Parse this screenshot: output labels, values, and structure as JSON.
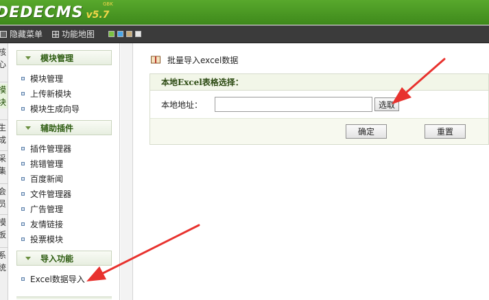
{
  "header": {
    "logo_text": "DEDECMS",
    "logo_version": "v5.7",
    "logo_sub": "GBK"
  },
  "toolbar": {
    "hide_menu_label": "隐藏菜单",
    "function_map_label": "功能地图",
    "color_swatches": [
      "#7bc142",
      "#4aa6e8",
      "#c7ab7a",
      "#e5e5e5"
    ]
  },
  "vertical_tabs": [
    {
      "label": "核心"
    },
    {
      "label": "模块",
      "active": true
    },
    {
      "label": "生成"
    },
    {
      "label": "采集"
    },
    {
      "label": "会员"
    },
    {
      "label": "模板"
    },
    {
      "label": "系统"
    }
  ],
  "sidebar": {
    "sections": [
      {
        "title": "模块管理",
        "items": [
          "模块管理",
          "上传新模块",
          "模块生成向导"
        ]
      },
      {
        "title": "辅助插件",
        "items": [
          "插件管理器",
          "挑错管理",
          "百度新闻",
          "文件管理器",
          "广告管理",
          "友情链接",
          "投票模块"
        ]
      },
      {
        "title": "导入功能",
        "items": [
          "Excel数据导入"
        ]
      }
    ]
  },
  "main": {
    "page_title": "批量导入excel数据",
    "panel_title": "本地Excel表格选择：",
    "file_label": "本地地址：",
    "file_value": "",
    "browse_label": "选取",
    "ok_label": "确定",
    "reset_label": "重置"
  },
  "colors": {
    "header_green": "#4a9a22",
    "annotation_red": "#e8322e"
  }
}
